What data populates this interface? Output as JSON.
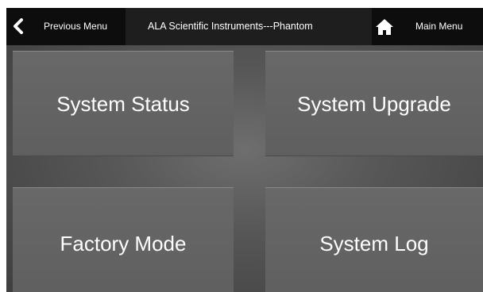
{
  "topbar": {
    "previous_label": "Previous Menu",
    "title": "ALA Scientific Instruments---Phantom",
    "main_label": "Main Menu",
    "icons": {
      "back": "chevron-left-icon",
      "home": "home-icon"
    }
  },
  "tiles": [
    {
      "label": "System Status"
    },
    {
      "label": "System Upgrade"
    },
    {
      "label": "Factory Mode"
    },
    {
      "label": "System Log"
    }
  ],
  "colors": {
    "topbar_bg": "#141414",
    "tile_bg": "#666666",
    "background": "#575757",
    "text": "#ffffff"
  }
}
